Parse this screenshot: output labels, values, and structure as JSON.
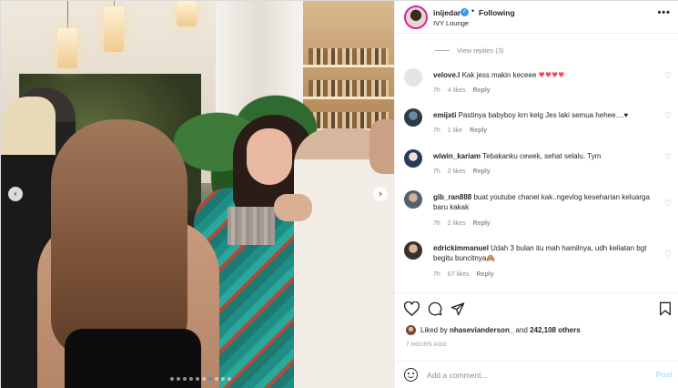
{
  "post": {
    "username": "inijedar",
    "follow_status": "Following",
    "location": "IVY Lounge",
    "more_label": "•••"
  },
  "thread": {
    "view_replies": "View replies (3)"
  },
  "comments": [
    {
      "username": "velove.l",
      "text": " Kak jess makin keceee",
      "emoji": "♥♥♥♥",
      "time": "7h",
      "likes": "4 likes",
      "reply": "Reply"
    },
    {
      "username": "emijati",
      "text": " Pastinya babyboy krn kelg Jes laki semua hehee....♥",
      "time": "7h",
      "likes": "1 like",
      "reply": "Reply"
    },
    {
      "username": "wiwin_kariam",
      "text": " Tebakanku cewek, sehat selalu. Tym",
      "time": "7h",
      "likes": "2 likes",
      "reply": "Reply"
    },
    {
      "username": "gib_ran888",
      "text": " buat youtube chanel kak..ngevlog keseharian keluarga baru kakak",
      "time": "7h",
      "likes": "2 likes",
      "reply": "Reply"
    },
    {
      "username": "edrickimmanuel",
      "text": " Udah 3 bulan itu mah hamilnya, udh keliatan bgt begitu buncitnya",
      "emoji": "🙈",
      "time": "7h",
      "likes": "67 likes",
      "reply": "Reply"
    }
  ],
  "likes": {
    "prefix": "Liked by ",
    "user": "nhasevianderson_",
    "middle": " and ",
    "count": "242,108 others"
  },
  "timestamp": "7 HOURS AGO",
  "composer": {
    "placeholder": "Add a comment...",
    "post_label": "Post"
  },
  "carousel": {
    "total_slides": 10,
    "active_slide": 7
  },
  "colors": {
    "accent": "#3897f0",
    "heart_red": "#ed4956",
    "muted": "#8e8e8e",
    "text": "#262626"
  }
}
